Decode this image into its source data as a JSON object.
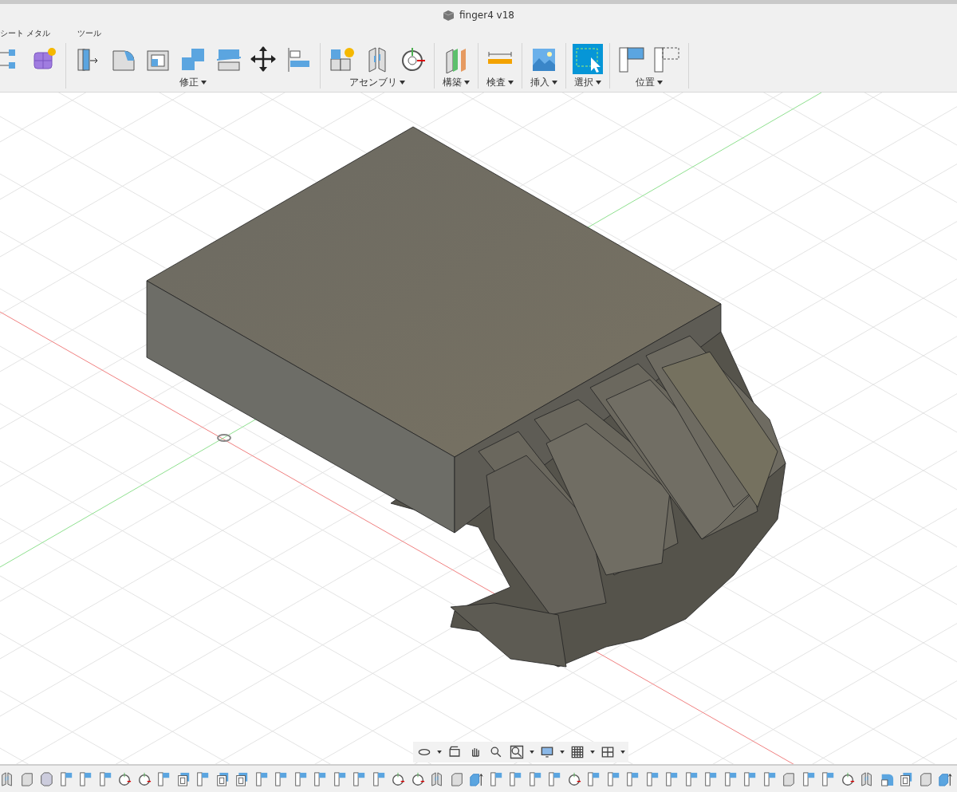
{
  "window": {
    "title": "finger4 v18"
  },
  "tabs": [
    {
      "label": "シート メタル"
    },
    {
      "label": "ツール"
    }
  ],
  "toolbar_groups": [
    {
      "kind": "create",
      "selected": false
    },
    {
      "kind": "modify",
      "label": "修正",
      "selected": false
    },
    {
      "kind": "assemble",
      "label": "アセンブリ",
      "selected": false
    },
    {
      "kind": "construct",
      "label": "構築",
      "selected": false
    },
    {
      "kind": "inspect",
      "label": "検査",
      "selected": false
    },
    {
      "kind": "insert",
      "label": "挿入",
      "selected": false
    },
    {
      "kind": "select",
      "label": "選択",
      "selected": true
    },
    {
      "kind": "position",
      "label": "位置",
      "selected": false
    }
  ]
}
